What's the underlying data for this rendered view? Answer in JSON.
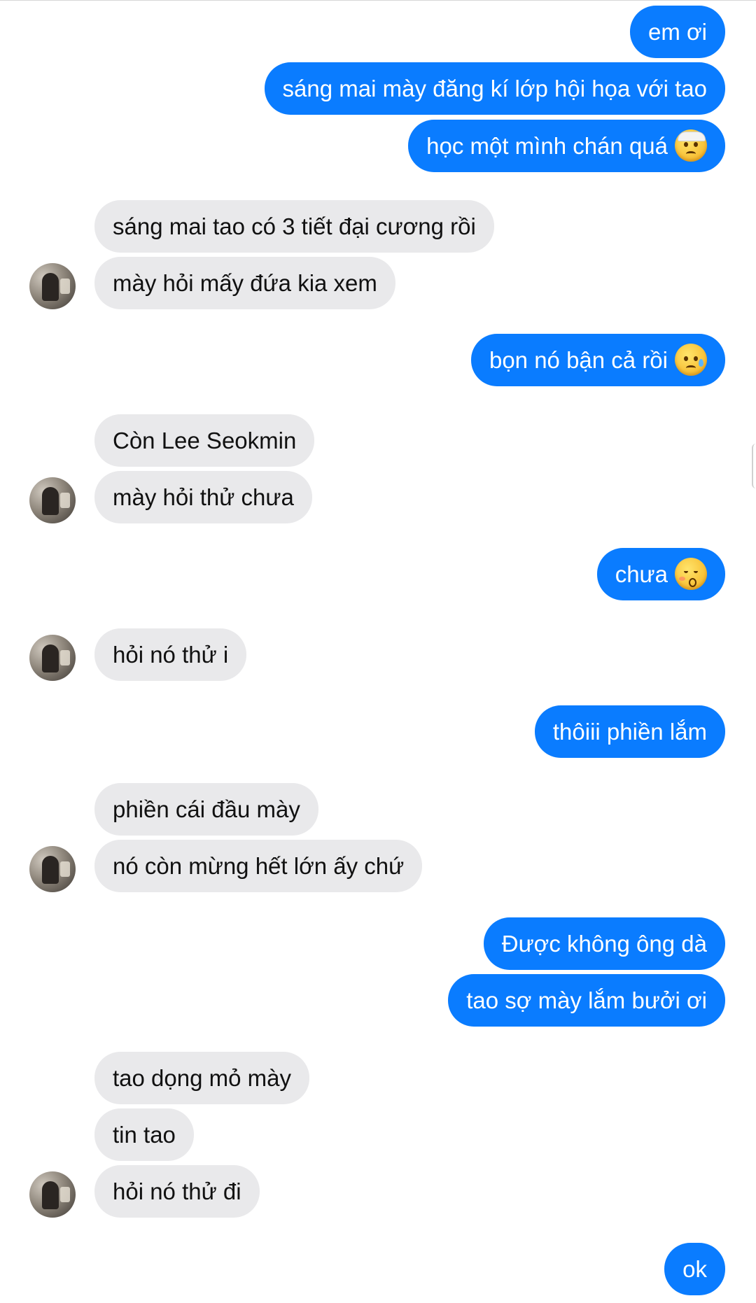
{
  "messages": [
    {
      "side": "out",
      "text": "em ơi"
    },
    {
      "side": "out",
      "text": "sáng mai mày đăng kí lớp hội họa với tao"
    },
    {
      "side": "out",
      "text": "học một mình chán quá",
      "emoji": "face-with-head-bandage-emoji"
    },
    {
      "side": "in",
      "text": "sáng mai tao có 3 tiết đại cương rồi"
    },
    {
      "side": "in",
      "text": "mày hỏi mấy đứa kia xem"
    },
    {
      "side": "out",
      "text": "bọn nó bận cả rồi",
      "emoji": "sad-but-relieved-face-emoji"
    },
    {
      "side": "in",
      "text": "Còn Lee Seokmin"
    },
    {
      "side": "in",
      "text": "mày hỏi thử chưa"
    },
    {
      "side": "out",
      "text": "chưa",
      "emoji": "kissing-face-with-closed-eyes-emoji"
    },
    {
      "side": "in",
      "text": "hỏi nó thử i"
    },
    {
      "side": "out",
      "text": "thôiii phiền lắm"
    },
    {
      "side": "in",
      "text": "phiền cái đầu mày"
    },
    {
      "side": "in",
      "text": "nó còn mừng hết lớn ấy chứ"
    },
    {
      "side": "out",
      "text": "Được không ông dà"
    },
    {
      "side": "out",
      "text": "tao sợ mày lắm bưởi ơi"
    },
    {
      "side": "in",
      "text": "tao dọng mỏ mày"
    },
    {
      "side": "in",
      "text": "tin tao"
    },
    {
      "side": "in",
      "text": "hỏi nó thử đi"
    },
    {
      "side": "out",
      "text": "ok"
    }
  ],
  "contact": {
    "avatar_icon": "contact-avatar"
  },
  "colors": {
    "outgoing_bubble": "#0a7cff",
    "incoming_bubble": "#e9e9eb",
    "background": "#ffffff"
  }
}
